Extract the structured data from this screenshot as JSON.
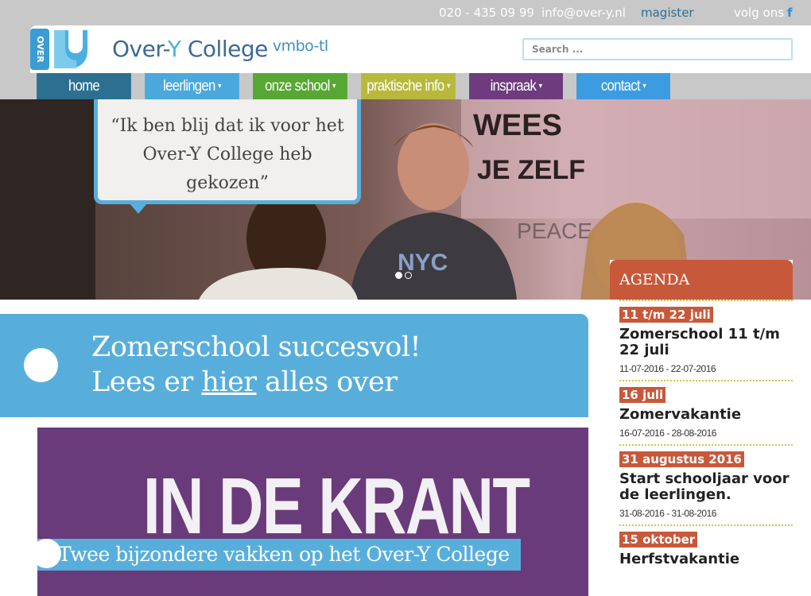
{
  "topbar": {
    "phone": "020 - 435 09 99",
    "email": "info@over-y.nl",
    "magister": "magister",
    "follow": "volg ons",
    "facebook_glyph": "f"
  },
  "header": {
    "logo_text": "OVER",
    "brand_over": "Over-",
    "brand_y": "Y",
    "brand_college": " College",
    "brand_sub": "vmbo-tl",
    "search_placeholder": "Search ..."
  },
  "nav": {
    "items": [
      {
        "label": "home",
        "color": "#2d6f91",
        "caret": ""
      },
      {
        "label": "leerlingen",
        "color": "#4aa8dc",
        "caret": "▾"
      },
      {
        "label": "onze school",
        "color": "#57a734",
        "caret": "▾"
      },
      {
        "label": "praktische info",
        "color": "#b7b93c",
        "caret": "▾"
      },
      {
        "label": "inspraak",
        "color": "#6d3b7e",
        "caret": "▾"
      },
      {
        "label": "contact",
        "color": "#3d9be0",
        "caret": "▾"
      }
    ]
  },
  "hero": {
    "quote_line1": "“Ik ben blij dat ik voor het",
    "quote_line2": "Over-Y College heb",
    "quote_line3": "gekozen”",
    "wall_text_1": "WEES",
    "wall_text_2": "JE ZELF",
    "wall_text_3": "PEACE",
    "shirt_text": "NYC",
    "slides": 2,
    "active_slide": 1
  },
  "banner": {
    "line1": "Zomerschool succesvol!",
    "line2_before": "Lees er ",
    "line2_link": "hier",
    "line2_after": " alles over"
  },
  "news": {
    "headline": "IN DE KRANT",
    "caption": "Twee bijzondere vakken op het Over-Y College"
  },
  "agenda": {
    "title": "AGENDA",
    "items": [
      {
        "date": "11 t/m 22 juli",
        "title": "Zomerschool 11 t/m 22 juli",
        "range": "11-07-2016 - 22-07-2016"
      },
      {
        "date": "16 juli",
        "title": "Zomervakantie",
        "range": "16-07-2016 - 28-08-2016"
      },
      {
        "date": "31 augustus 2016",
        "title": "Start schooljaar voor de leerlingen.",
        "range": "31-08-2016 - 31-08-2016"
      },
      {
        "date": "15 oktober",
        "title": "Herfstvakantie",
        "range": ""
      }
    ]
  },
  "colors": {
    "accent_blue": "#58aedb",
    "agenda_orange": "#c8583a",
    "news_purple": "#6a3b7a"
  }
}
